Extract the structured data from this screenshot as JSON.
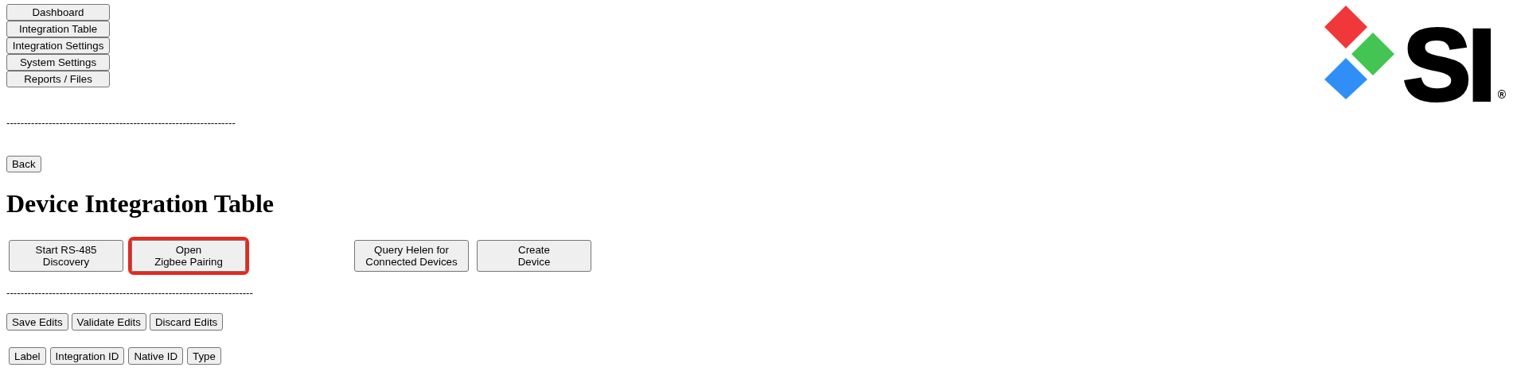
{
  "nav_buttons": [
    "Dashboard",
    "Integration Table",
    "Integration Settings",
    "System Settings",
    "Reports / Files"
  ],
  "logo": {
    "text": "SI",
    "mark": "®"
  },
  "separator_1": "-----------------------------------------------------------------",
  "back_button": "Back",
  "heading": "Device Integration Table",
  "action_groups": [
    {
      "buttons": [
        {
          "lines": [
            "Start RS-485",
            "Discovery"
          ],
          "highlighted": false
        },
        {
          "lines": [
            "Open",
            "Zigbee Pairing"
          ],
          "highlighted": true
        }
      ]
    },
    {
      "buttons": [
        {
          "lines": [
            "Query Helen for",
            "Connected Devices"
          ],
          "highlighted": false
        },
        {
          "lines": [
            "Create",
            "Device"
          ],
          "highlighted": false
        }
      ]
    }
  ],
  "separator_2": "----------------------------------------------------------------------",
  "edit_buttons": [
    "Save Edits",
    "Validate Edits",
    "Discard Edits"
  ],
  "column_buttons": [
    "Label",
    "Integration ID",
    "Native ID",
    "Type"
  ]
}
